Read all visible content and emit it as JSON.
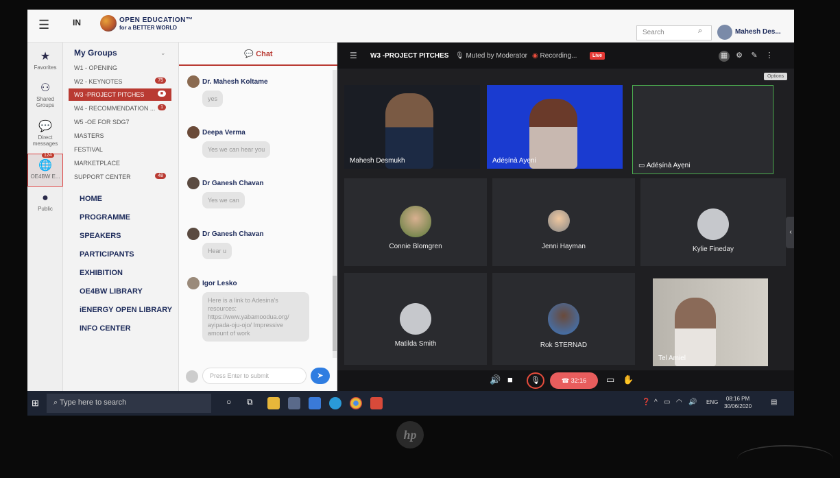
{
  "topbar": {
    "brand_mark": "IN",
    "logo_line1": "OPEN EDUCATION™",
    "logo_line2": "for a BETTER WORLD",
    "search_placeholder": "Search",
    "user_name": "Mahesh Des..."
  },
  "rail": [
    {
      "label": "Favorites",
      "icon": "star-icon"
    },
    {
      "label": "Shared Groups",
      "icon": "shared-groups-icon"
    },
    {
      "label": "Direct messages",
      "icon": "chat-bubble-icon"
    },
    {
      "label": "OE4BW E...",
      "icon": "globe-icon",
      "badge": "124"
    },
    {
      "label": "Public",
      "icon": "oe4bw-logo-icon"
    }
  ],
  "groups": {
    "title": "My Groups",
    "items": [
      {
        "label": "W1 - OPENING",
        "badge": ""
      },
      {
        "label": "W2 - KEYNOTES",
        "badge": "75"
      },
      {
        "label": "W3 -PROJECT PITCHES",
        "badge": ""
      },
      {
        "label": "W4 - RECOMMENDATION ...",
        "badge": "1"
      },
      {
        "label": "W5 -OE FOR SDG7",
        "badge": ""
      },
      {
        "label": "MASTERS",
        "badge": ""
      },
      {
        "label": "FESTIVAL",
        "badge": ""
      },
      {
        "label": "MARKETPLACE",
        "badge": ""
      },
      {
        "label": "SUPPORT CENTER",
        "badge": "48"
      }
    ],
    "nav": [
      "HOME",
      "PROGRAMME",
      "SPEAKERS",
      "PARTICIPANTS",
      "EXHIBITION",
      "OE4BW LIBRARY",
      "iENERGY OPEN LIBRARY",
      "INFO CENTER"
    ]
  },
  "chat": {
    "header": "Chat",
    "messages": [
      {
        "name": "Dr. Mahesh Koltame",
        "text": "yes"
      },
      {
        "name": "Deepa Verma",
        "text": "Yes we can hear you"
      },
      {
        "name": "Dr Ganesh Chavan",
        "text": "Yes we can"
      },
      {
        "name": "Dr Ganesh Chavan",
        "text": "Hear u"
      },
      {
        "name": "Igor Lesko",
        "text": "Here is a link to Adesina's resources: https://www.yabamoodua.org/ ayipada-oju-ojo/ Impressive amount of work"
      }
    ],
    "input_placeholder": "Press Enter to submit"
  },
  "video": {
    "title": "W3 -PROJECT PITCHES",
    "muted": "Muted by Moderator",
    "recording": "Recording...",
    "live": "Live",
    "tooltip": "Options",
    "participants": [
      {
        "name": "Mahesh Desmukh"
      },
      {
        "name": "Adéṣínà Ayẹni"
      },
      {
        "name": "Adéṣínà Ayẹni"
      },
      {
        "name": "Connie Blomgren"
      },
      {
        "name": "Jenni Hayman"
      },
      {
        "name": "Kylie Fineday"
      },
      {
        "name": "Matilda Smith"
      },
      {
        "name": "Rok STERNAD"
      },
      {
        "name": "Tel Amiel"
      }
    ],
    "call_timer": "32:16"
  },
  "taskbar": {
    "search_placeholder": "Type here to search",
    "lang": "ENG",
    "time": "08:16 PM",
    "date": "30/06/2020"
  }
}
